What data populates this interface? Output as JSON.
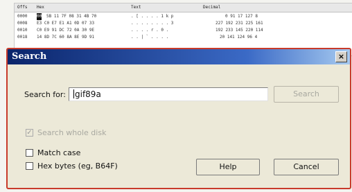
{
  "hex_view": {
    "header": {
      "offset": "Offs",
      "hex": "Hex",
      "text": "Text",
      "decimal": "Decimal"
    },
    "rows": [
      {
        "offset": "0000",
        "selected_byte": "00",
        "hex": "5B 11 7F 08 31 4B 70",
        "text": ". [ . . . . 1 k p",
        "decimal": "0   91   17 127   8"
      },
      {
        "offset": "0008",
        "selected_byte": "",
        "hex": "E3 C0 E7 E1 A1 0D 07 33",
        "text": ". . . . . . . . 3",
        "decimal": "227 192 231 225 161"
      },
      {
        "offset": "0010",
        "selected_byte": "",
        "hex": "C0 E9 91 DC 72 0A 30 9E",
        "text": ". . . . r . 0 .",
        "decimal": "192 233 145 220 114"
      },
      {
        "offset": "0018",
        "selected_byte": "",
        "hex": "14 8D 7C 60 8A 8E 9D 91",
        "text": ". . | ` . . . .",
        "decimal": "20 141 124  96   4"
      }
    ]
  },
  "dialog": {
    "title": "Search",
    "close_label": "×",
    "search_for_label": "Search for:",
    "search_value": "gif89a",
    "search_button": "Search",
    "search_whole_disk_label": "Search whole disk",
    "search_whole_disk_checked": true,
    "match_case_label": "Match case",
    "match_case_checked": false,
    "hex_bytes_label": "Hex bytes (eg, B64F)",
    "hex_bytes_checked": false,
    "help_button": "Help",
    "cancel_button": "Cancel"
  }
}
